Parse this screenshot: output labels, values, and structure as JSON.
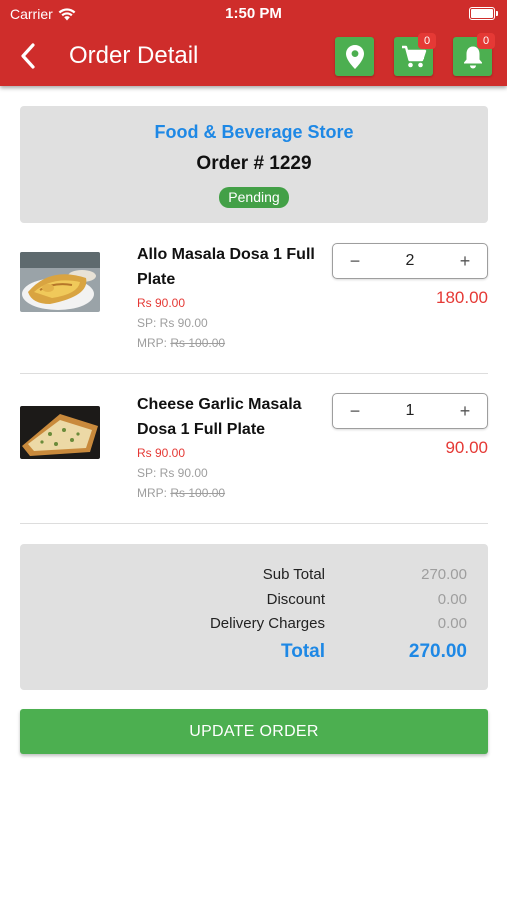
{
  "status_bar": {
    "carrier": "Carrier",
    "time": "1:50 PM"
  },
  "header": {
    "title": "Order Detail",
    "cart_count": "0",
    "notification_count": "0",
    "bar_color": "#cf2d2b",
    "button_color": "#4caf50",
    "icons": [
      "back-arrow-icon",
      "location-pin-icon",
      "cart-icon",
      "bell-icon"
    ]
  },
  "store": {
    "name": "Food & Beverage Store",
    "order_number": "Order # 1229",
    "status": "Pending"
  },
  "items": [
    {
      "name": "Allo Masala Dosa 1 Full Plate",
      "price": "Rs 90.00",
      "sp": "SP: Rs 90.00",
      "mrp_label": "MRP:",
      "mrp_value": "Rs 100.00",
      "quantity": "2",
      "line_total": "180.00"
    },
    {
      "name": "Cheese Garlic Masala Dosa 1 Full Plate",
      "price": "Rs 90.00",
      "sp": "SP: Rs 90.00",
      "mrp_label": "MRP:",
      "mrp_value": "Rs 100.00",
      "quantity": "1",
      "line_total": "90.00"
    }
  ],
  "stepper": {
    "minus": "−",
    "plus": "+"
  },
  "summary": {
    "sub_total_label": "Sub Total",
    "sub_total_value": "270.00",
    "discount_label": "Discount",
    "discount_value": "0.00",
    "delivery_label": "Delivery Charges",
    "delivery_value": "0.00",
    "total_label": "Total",
    "total_value": "270.00"
  },
  "update_button": "UPDATE ORDER",
  "colors": {
    "accent_blue": "#1e88e5",
    "price_red": "#e53935",
    "pending_green": "#43a047"
  }
}
